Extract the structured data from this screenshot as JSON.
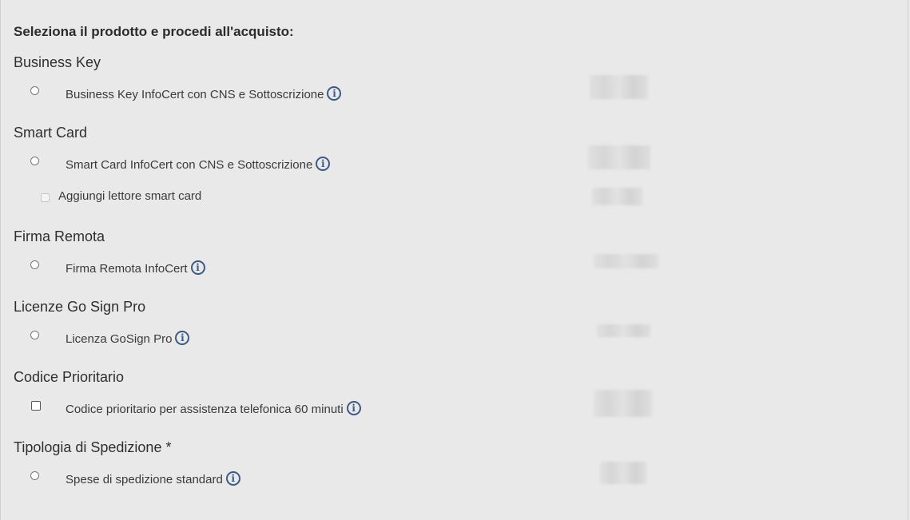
{
  "heading": "Seleziona il prodotto e procedi all'acquisto:",
  "sections": [
    {
      "title": "Business Key",
      "options": [
        {
          "type": "radio",
          "label": "Business Key InfoCert con CNS e Sottoscrizione",
          "info": true
        }
      ]
    },
    {
      "title": "Smart Card",
      "options": [
        {
          "type": "radio",
          "label": "Smart Card InfoCert con CNS e Sottoscrizione",
          "info": true
        },
        {
          "type": "checkbox-disabled",
          "label": "Aggiungi lettore smart card",
          "info": false
        }
      ]
    },
    {
      "title": "Firma Remota",
      "options": [
        {
          "type": "radio",
          "label": "Firma Remota InfoCert",
          "info": true
        }
      ]
    },
    {
      "title": "Licenze Go Sign Pro",
      "options": [
        {
          "type": "radio",
          "label": "Licenza GoSign Pro",
          "info": true
        }
      ]
    },
    {
      "title": "Codice Prioritario",
      "options": [
        {
          "type": "checkbox",
          "label": "Codice prioritario per assistenza telefonica 60 minuti",
          "info": true
        }
      ]
    },
    {
      "title": "Tipologia di Spedizione *",
      "options": [
        {
          "type": "radio",
          "label": "Spese di spedizione standard",
          "info": true
        }
      ]
    }
  ],
  "info_glyph": "i",
  "colors": {
    "background": "#e9e9e9",
    "info_icon": "#3c5a86",
    "text": "#333333"
  }
}
